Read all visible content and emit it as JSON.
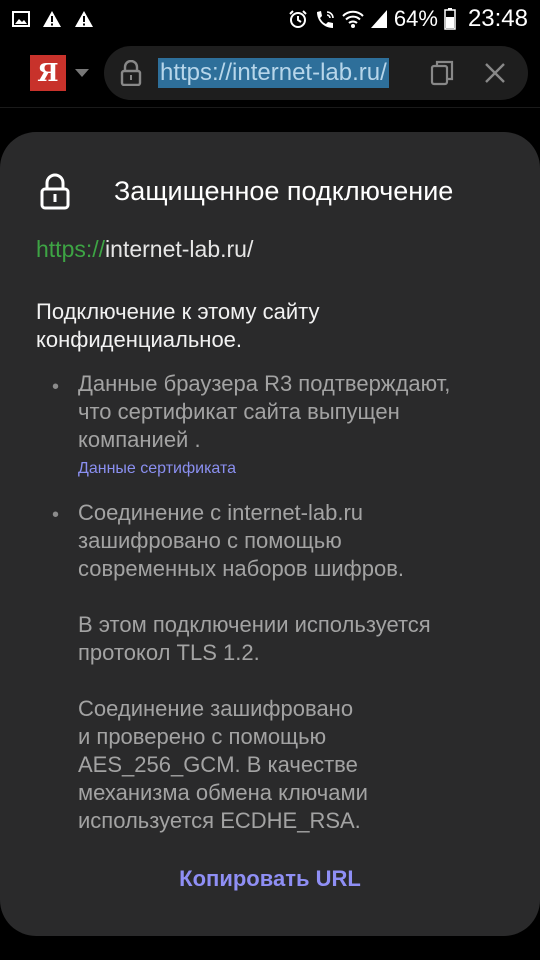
{
  "status_bar": {
    "battery": "64%",
    "time": "23:48",
    "icons": [
      "image-icon",
      "warning-icon",
      "warning-icon",
      "alarm-icon",
      "wifi-call-icon",
      "wifi-icon",
      "signal-icon",
      "battery-icon"
    ]
  },
  "browser": {
    "logo": "Я",
    "url": "https://internet-lab.ru/"
  },
  "sheet": {
    "title": "Защищенное подключение",
    "url_scheme": "https://",
    "url_host": "internet-lab.ru/",
    "summary_line1": "Подключение к этому сайту",
    "summary_line2": "конфиденциальное.",
    "item1_line1": "Данные браузера R3 подтверждают,",
    "item1_line2": "что сертификат сайта выпущен",
    "item1_line3": "компанией .",
    "cert_link": "Данные сертификата",
    "item2_line1": "Соединение с internet-lab.ru",
    "item2_line2": "зашифровано с помощью",
    "item2_line3": "современных наборов шифров.",
    "tls_line1": "В этом подключении используется",
    "tls_line2": "протокол TLS 1.2.",
    "enc_line1": "Соединение зашифровано",
    "enc_line2": "и проверено с помощью",
    "enc_line3": "AES_256_GCM. В качестве",
    "enc_line4": "механизма обмена ключами",
    "enc_line5": "используется ECDHE_RSA.",
    "copy_url": "Копировать URL"
  }
}
